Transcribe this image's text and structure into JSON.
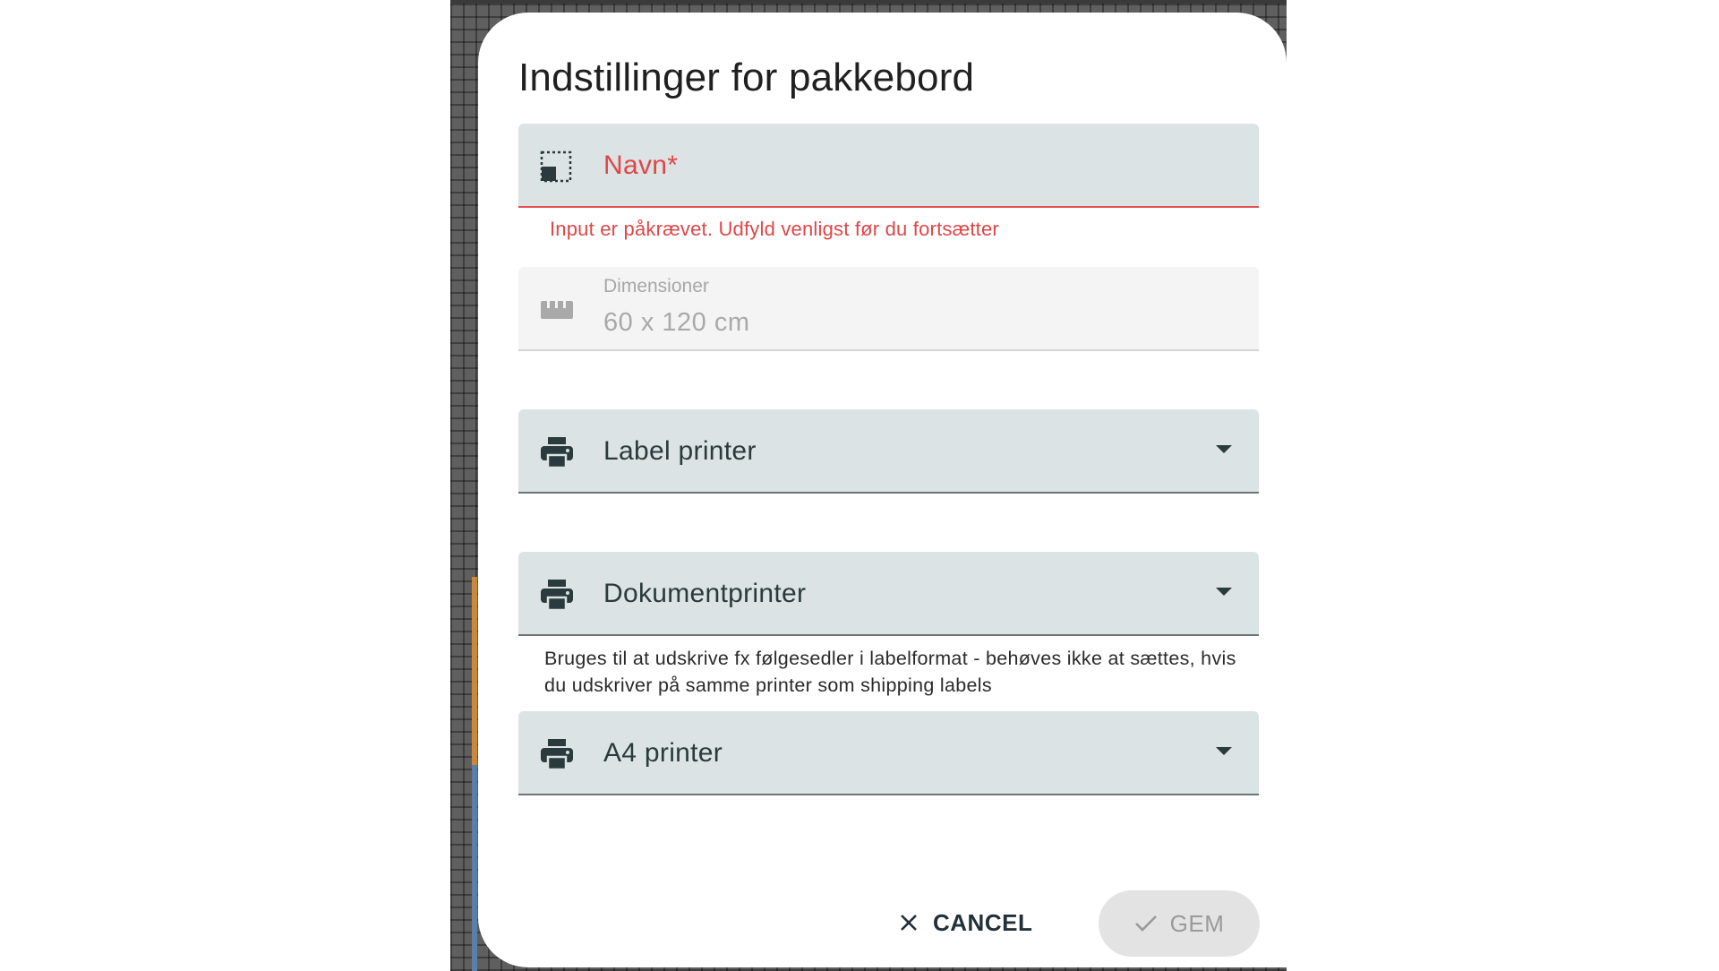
{
  "dialog": {
    "title": "Indstillinger for pakkebord",
    "name_field": {
      "label": "Navn*",
      "icon": "selection-icon",
      "error": "Input er påkrævet. Udfyld venligst før du fortsætter"
    },
    "dimensions_field": {
      "label": "Dimensioner",
      "value": "60 x 120 cm",
      "icon": "ruler-icon"
    },
    "label_printer": {
      "label": "Label printer",
      "icon": "printer-icon"
    },
    "document_printer": {
      "label": "Dokumentprinter",
      "icon": "printer-icon",
      "helper": "Bruges til at udskrive fx følgesedler i labelformat - behøves ikke at sættes, hvis du udskriver på samme printer som shipping labels"
    },
    "a4_printer": {
      "label": "A4 printer",
      "icon": "printer-icon"
    },
    "actions": {
      "cancel_label": "CANCEL",
      "save_label": "GEM"
    }
  },
  "colors": {
    "field_bg": "#dce3e4",
    "error": "#e04646",
    "disabled_bg": "#f4f4f4",
    "save_disabled_bg": "#e3e3e3"
  }
}
